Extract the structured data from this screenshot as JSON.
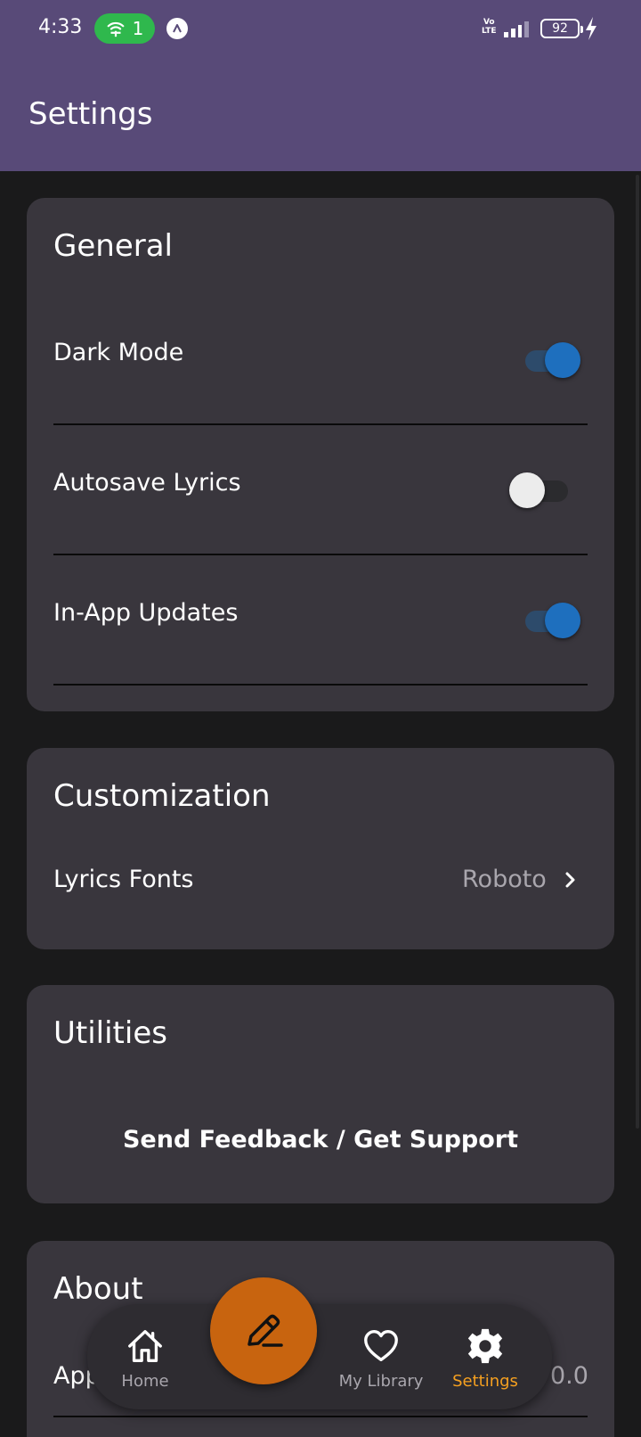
{
  "status_bar": {
    "time": "4:33",
    "hotspot_count": "1",
    "network_label_top": "Vo",
    "network_label_bottom": "LTE",
    "battery": "92"
  },
  "app_bar": {
    "title": "Settings"
  },
  "general": {
    "title": "General",
    "items": [
      {
        "label": "Dark Mode",
        "enabled": true
      },
      {
        "label": "Autosave Lyrics",
        "enabled": false
      },
      {
        "label": "In-App Updates",
        "enabled": true
      }
    ]
  },
  "customization": {
    "title": "Customization",
    "fonts_label": "Lyrics Fonts",
    "fonts_value": "Roboto"
  },
  "utilities": {
    "title": "Utilities",
    "feedback_label": "Send Feedback / Get Support"
  },
  "about": {
    "title": "About",
    "version_label_partial": "App",
    "version_value_partial": "0.0"
  },
  "bottom_nav": {
    "home": "Home",
    "library": "My Library",
    "settings": "Settings",
    "active_color": "#f5a020",
    "fab_color": "#c8640f"
  },
  "colors": {
    "app_bar": "#584a78",
    "card": "#39363d",
    "toggle_on": "#1e6fbe"
  }
}
